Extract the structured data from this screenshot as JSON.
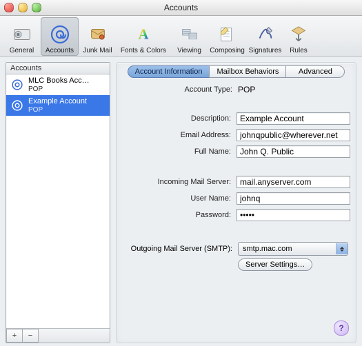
{
  "window": {
    "title": "Accounts"
  },
  "toolbar": {
    "items": [
      {
        "label": "General"
      },
      {
        "label": "Accounts"
      },
      {
        "label": "Junk Mail"
      },
      {
        "label": "Fonts & Colors"
      },
      {
        "label": "Viewing"
      },
      {
        "label": "Composing"
      },
      {
        "label": "Signatures"
      },
      {
        "label": "Rules"
      }
    ],
    "active_index": 1
  },
  "sidebar": {
    "header": "Accounts",
    "accounts": [
      {
        "name": "MLC Books Acc…",
        "sub": "POP",
        "selected": false
      },
      {
        "name": "Example Account",
        "sub": "POP",
        "selected": true
      }
    ],
    "add_label": "+",
    "remove_label": "−"
  },
  "tabs": {
    "items": [
      {
        "label": "Account Information"
      },
      {
        "label": "Mailbox Behaviors"
      },
      {
        "label": "Advanced"
      }
    ],
    "active_index": 0
  },
  "form": {
    "account_type_label": "Account Type:",
    "account_type_value": "POP",
    "description_label": "Description:",
    "description_value": "Example Account",
    "email_label": "Email Address:",
    "email_value": "johnqpublic@wherever.net",
    "fullname_label": "Full Name:",
    "fullname_value": "John Q. Public",
    "incoming_label": "Incoming Mail Server:",
    "incoming_value": "mail.anyserver.com",
    "username_label": "User Name:",
    "username_value": "johnq",
    "password_label": "Password:",
    "password_value": "•••••",
    "smtp_label": "Outgoing Mail Server (SMTP):",
    "smtp_value": "smtp.mac.com",
    "server_settings_label": "Server Settings…"
  },
  "help_label": "?"
}
